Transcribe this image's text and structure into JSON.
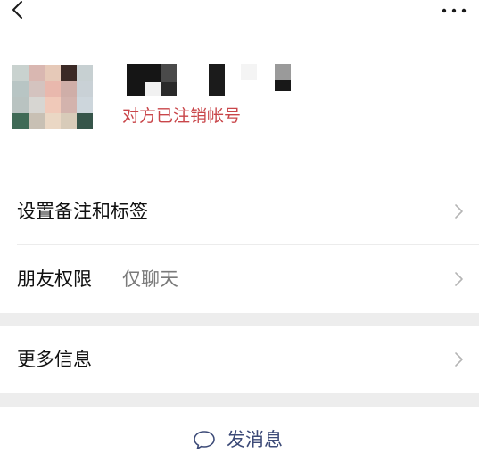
{
  "topbar": {
    "back_icon": "chevron-left-icon",
    "more_icon": "more-dots-icon"
  },
  "profile": {
    "status_text": "对方已注销帐号",
    "status_color": "#c9464a"
  },
  "menu": {
    "remark_label": "设置备注和标签",
    "permission_label": "朋友权限",
    "permission_value": "仅聊天",
    "more_info_label": "更多信息"
  },
  "actions": {
    "send_message_label": "发消息",
    "send_message_icon": "chat-bubble-icon",
    "accent_color": "#3d4b78"
  }
}
